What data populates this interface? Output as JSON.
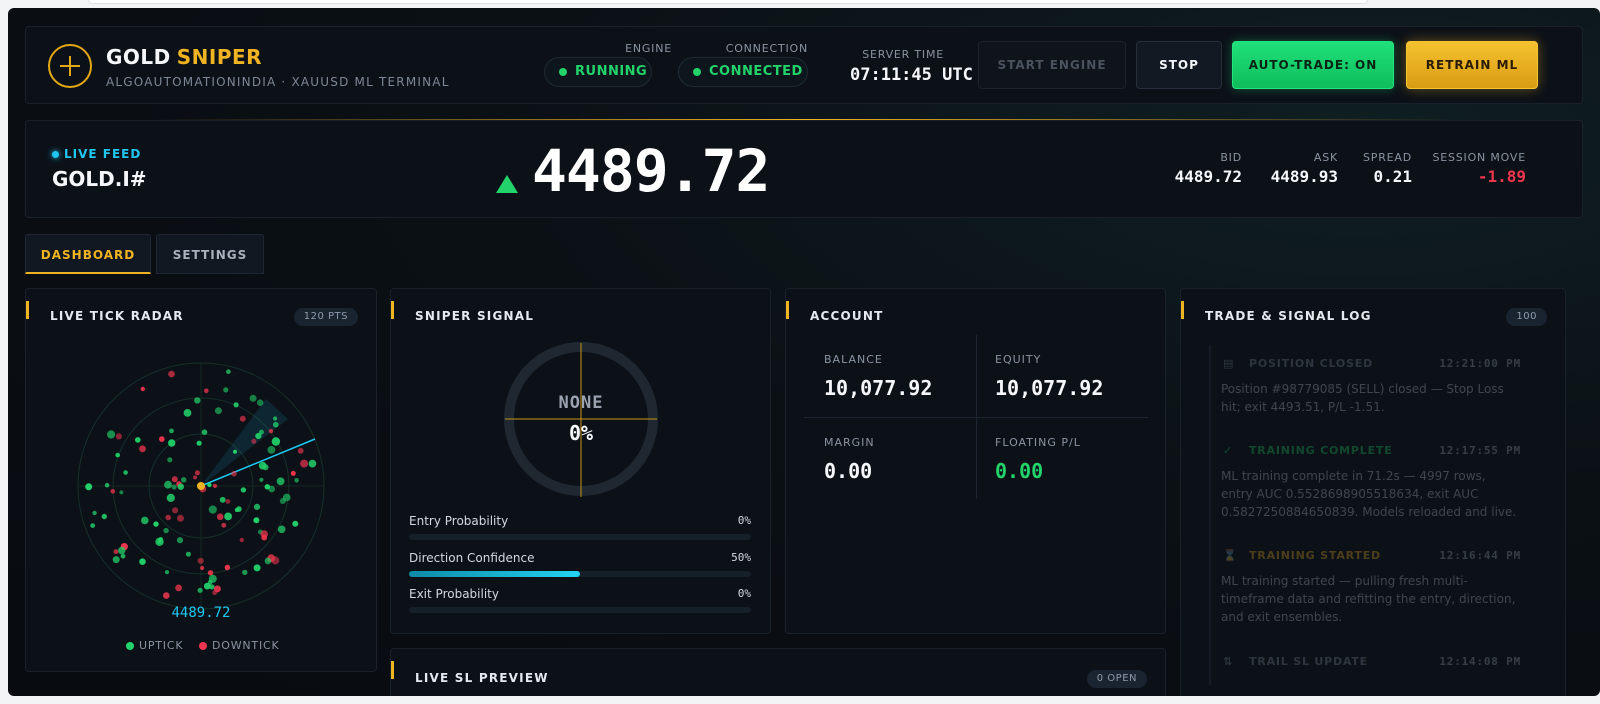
{
  "header": {
    "brand_word1": "GOLD",
    "brand_word2": "SNIPER",
    "subtitle": "ALGOAUTOMATIONINDIA · XAUUSD ML TERMINAL",
    "engine_label": "ENGINE",
    "engine_status": "RUNNING",
    "connection_label": "CONNECTION",
    "connection_status": "CONNECTED",
    "server_time_label": "SERVER TIME",
    "server_time": "07:11:45 UTC",
    "buttons": {
      "start": "START ENGINE",
      "stop": "STOP",
      "auto_trade": "AUTO-TRADE: ON",
      "retrain": "RETRAIN ML"
    }
  },
  "feed": {
    "live_label": "LIVE FEED",
    "symbol": "GOLD.I#",
    "price": "4489.72",
    "direction": "up",
    "bid_label": "BID",
    "bid": "4489.72",
    "ask_label": "ASK",
    "ask": "4489.93",
    "spread_label": "SPREAD",
    "spread": "0.21",
    "session_label": "SESSION MOVE",
    "session_move": "-1.89"
  },
  "tabs": {
    "dashboard": "DASHBOARD",
    "settings": "SETTINGS"
  },
  "radar": {
    "title": "LIVE TICK RADAR",
    "badge": "120 PTS",
    "price": "4489.72",
    "legend_up": "UPTICK",
    "legend_down": "DOWNTICK"
  },
  "signal": {
    "title": "SNIPER SIGNAL",
    "state": "NONE",
    "confidence": "0%",
    "rows": [
      {
        "label": "Entry Probability",
        "value": "0%",
        "level": 0.0
      },
      {
        "label": "Direction Confidence",
        "value": "50%",
        "level": 0.5
      },
      {
        "label": "Exit Probability",
        "value": "0%",
        "level": 0.0
      }
    ]
  },
  "account": {
    "title": "ACCOUNT",
    "balance_label": "BALANCE",
    "balance": "10,077.92",
    "equity_label": "EQUITY",
    "equity": "10,077.92",
    "margin_label": "MARGIN",
    "margin": "0.00",
    "floating_label": "FLOATING P/L",
    "floating": "0.00"
  },
  "sl_preview": {
    "title": "LIVE SL PREVIEW",
    "badge": "0 OPEN"
  },
  "log": {
    "title": "TRADE & SIGNAL LOG",
    "badge": "100",
    "entries": [
      {
        "icon": "lock-icon",
        "title": "POSITION CLOSED",
        "time": "12:21:00 PM",
        "body": "Position #98779085 (SELL) closed — Stop Loss hit; exit 4493.51, P/L -1.51."
      },
      {
        "icon": "check-icon",
        "title": "TRAINING COMPLETE",
        "time": "12:17:55 PM",
        "body": "ML training complete in 71.2s — 4997 rows, entry AUC 0.5528698905518634, exit AUC 0.5827250884650839. Models reloaded and live."
      },
      {
        "icon": "hourglass-icon",
        "title": "TRAINING STARTED",
        "time": "12:16:44 PM",
        "body": "ML training started — pulling fresh multi-timeframe data and refitting the entry, direction, and exit ensembles."
      },
      {
        "icon": "trail-icon",
        "title": "TRAIL SL UPDATE",
        "time": "12:14:08 PM",
        "body": ""
      }
    ]
  },
  "colors": {
    "gold": "#f0b321",
    "green": "#22d36a",
    "red": "#f0364e",
    "cyan": "#1fc7f0"
  }
}
